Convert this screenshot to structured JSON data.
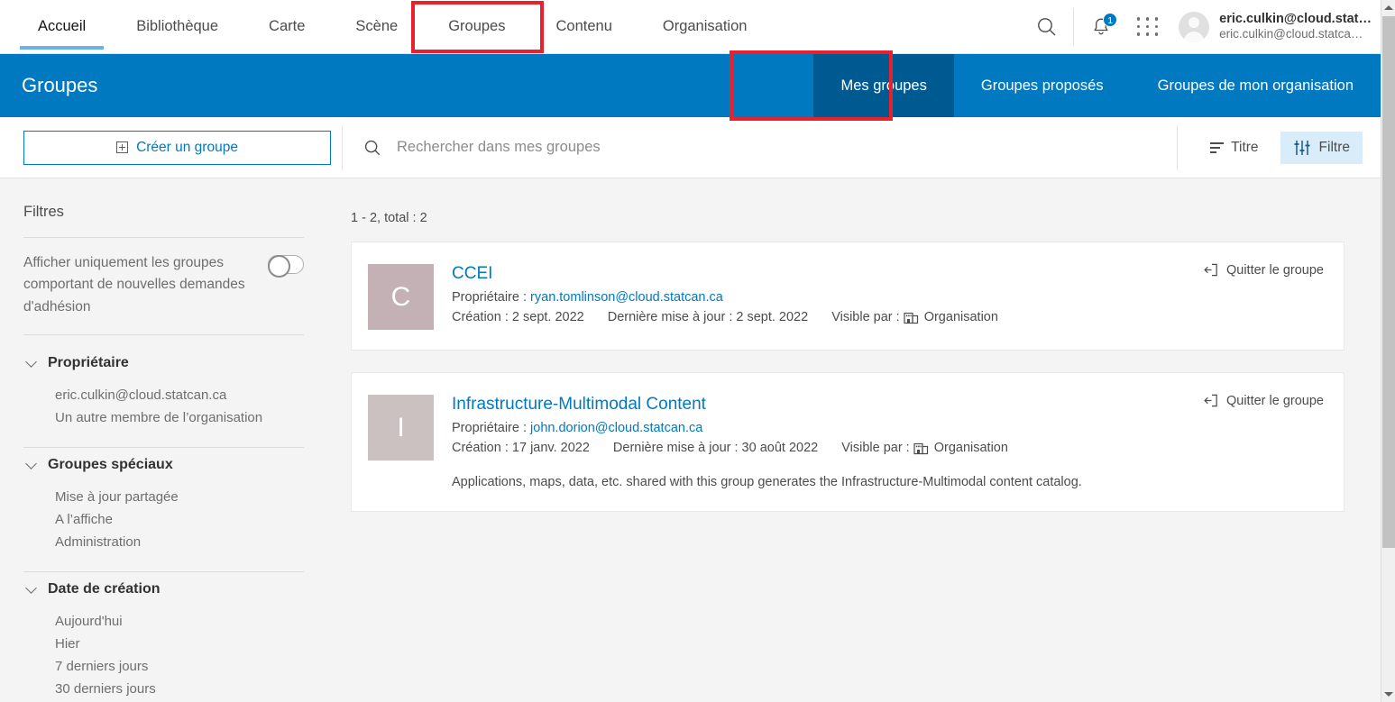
{
  "topnav": {
    "items": [
      {
        "label": "Accueil",
        "state": "active-light"
      },
      {
        "label": "Bibliothèque",
        "state": "normal"
      },
      {
        "label": "Carte",
        "state": "normal"
      },
      {
        "label": "Scène",
        "state": "normal"
      },
      {
        "label": "Groupes",
        "state": "active-dark"
      },
      {
        "label": "Contenu",
        "state": "normal"
      },
      {
        "label": "Organisation",
        "state": "normal"
      }
    ],
    "search_icon": "search-icon",
    "notifications_icon": "bell-icon",
    "notifications_badge": "1",
    "apps_icon": "app-grid-icon",
    "avatar_icon": "user-avatar-icon",
    "user_name": "eric.culkin@cloud.stat…",
    "user_sub": "eric.culkin@cloud.statca…"
  },
  "banner": {
    "title": "Groupes",
    "tabs": [
      {
        "label": "Mes groupes",
        "active": true
      },
      {
        "label": "Groupes proposés",
        "active": false
      },
      {
        "label": "Groupes de mon organisation",
        "active": false
      }
    ]
  },
  "toolbar": {
    "create_label": "Créer un groupe",
    "create_icon": "plus-square-icon",
    "search_icon": "search-icon",
    "search_placeholder": "Rechercher dans mes groupes",
    "search_value": "",
    "sort_label": "Titre",
    "sort_icon": "sort-descending-icon",
    "filter_label": "Filtre",
    "filter_icon": "sliders-icon"
  },
  "sidebar": {
    "heading": "Filtres",
    "toggle_label": "Afficher uniquement les groupes comportant de nouvelles demandes d'adhésion",
    "toggle_state": "off",
    "facets": [
      {
        "title": "Propriétaire",
        "chevron_icon": "chevron-down-icon",
        "items": [
          "eric.culkin@cloud.statcan.ca",
          "Un autre membre de l’organisation"
        ]
      },
      {
        "title": "Groupes spéciaux",
        "chevron_icon": "chevron-down-icon",
        "items": [
          "Mise à jour partagée",
          "A l’affiche",
          "Administration"
        ]
      },
      {
        "title": "Date de création",
        "chevron_icon": "chevron-down-icon",
        "items": [
          "Aujourd'hui",
          "Hier",
          "7 derniers jours",
          "30 derniers jours"
        ]
      }
    ]
  },
  "results": {
    "count_text": "1 - 2, total : 2",
    "owner_label": "Propriétaire :",
    "created_label": "Création :",
    "updated_label": "Dernière mise à jour :",
    "visible_label": "Visible par :",
    "leave_label": "Quitter le groupe",
    "leave_icon": "exit-group-icon",
    "org_icon": "organization-building-icon",
    "cards": [
      {
        "initial": "C",
        "thumb_color": "#c4b1b5",
        "title": "CCEI",
        "owner": "ryan.tomlinson@cloud.statcan.ca",
        "created": "2 sept. 2022",
        "updated": "2 sept. 2022",
        "visibility": "Organisation",
        "description": ""
      },
      {
        "initial": "I",
        "thumb_color": "#cbc1c0",
        "title": "Infrastructure-Multimodal Content",
        "owner": "john.dorion@cloud.statcan.ca",
        "created": "17 janv. 2022",
        "updated": "30 août 2022",
        "visibility": "Organisation",
        "description": "Applications, maps, data, etc. shared with this group generates the Infrastructure-Multimodal content catalog."
      }
    ]
  },
  "scrollbar": {
    "up_icon": "scroll-up-arrow-icon",
    "down_icon": "scroll-down-arrow-icon"
  },
  "annotations": {
    "accent_color": "#e8212e",
    "boxes": [
      "groupes-nav-item",
      "mes-groupes-tab"
    ]
  }
}
